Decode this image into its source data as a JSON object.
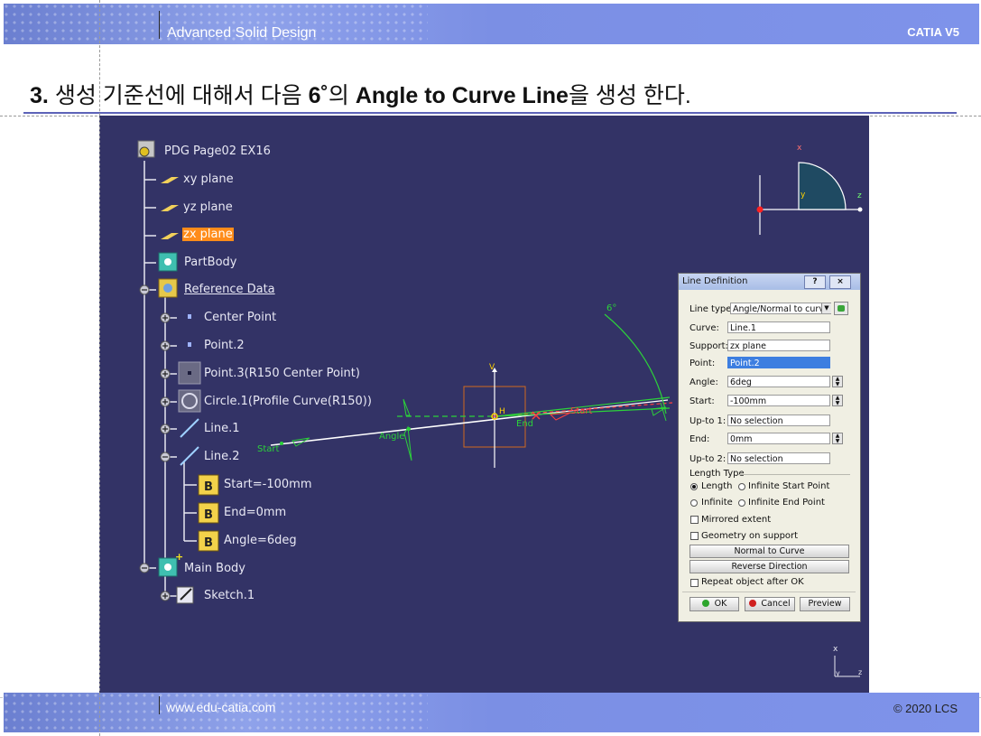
{
  "header": {
    "title": "Advanced Solid Design",
    "product": "CATIA V5"
  },
  "heading": {
    "number": "3.",
    "text_ko_1": "생성 기준선에 대해서 다음",
    "angle": "6˚",
    "text_ko_2": "의",
    "feature": "Angle to Curve Line",
    "text_ko_3": "을 생성 한다."
  },
  "tree": {
    "root": "PDG Page02 EX16",
    "items": [
      {
        "label": "xy plane"
      },
      {
        "label": "yz plane"
      },
      {
        "label": "zx plane"
      },
      {
        "label": "PartBody"
      },
      {
        "label": "Reference Data"
      },
      {
        "label": "Center Point"
      },
      {
        "label": "Point.2"
      },
      {
        "label": "Point.3(R150 Center Point)"
      },
      {
        "label": "Circle.1(Profile Curve(R150))"
      },
      {
        "label": "Line.1"
      },
      {
        "label": "Line.2"
      },
      {
        "label": "Start=-100mm"
      },
      {
        "label": "End=0mm"
      },
      {
        "label": "Angle=6deg"
      },
      {
        "label": "Main Body"
      },
      {
        "label": "Sketch.1"
      }
    ]
  },
  "geometry_labels": {
    "angle_mark": "6°",
    "start": "Start",
    "angle": "Angle",
    "end": "End",
    "start_red": "Start",
    "axis_v": "V",
    "axis_h": "H"
  },
  "compass": {
    "x": "x",
    "y": "y",
    "z": "z"
  },
  "dialog": {
    "title": "Line Definition",
    "help": "?",
    "close": "×",
    "line_type_label": "Line type:",
    "line_type_value": "Angle/Normal to curve",
    "curve_label": "Curve:",
    "curve_value": "Line.1",
    "support_label": "Support:",
    "support_value": "zx plane",
    "point_label": "Point:",
    "point_value": "Point.2",
    "angle_label": "Angle:",
    "angle_value": "6deg",
    "start_label": "Start:",
    "start_value": "-100mm",
    "upto1_label": "Up-to 1:",
    "upto1_value": "No selection",
    "end_label": "End:",
    "end_value": "0mm",
    "upto2_label": "Up-to 2:",
    "upto2_value": "No selection",
    "length_type": "Length Type",
    "opt_length": "Length",
    "opt_inf_start": "Infinite Start Point",
    "opt_infinite": "Infinite",
    "opt_inf_end": "Infinite End Point",
    "mirrored": "Mirrored extent",
    "geometry_support": "Geometry on support",
    "normal_to_curve": "Normal to Curve",
    "reverse_direction": "Reverse Direction",
    "repeat": "Repeat object after OK",
    "ok": "OK",
    "cancel": "Cancel",
    "preview": "Preview"
  },
  "footer": {
    "url": "www.edu-catia.com",
    "copyright": "© 2020 LCS"
  }
}
